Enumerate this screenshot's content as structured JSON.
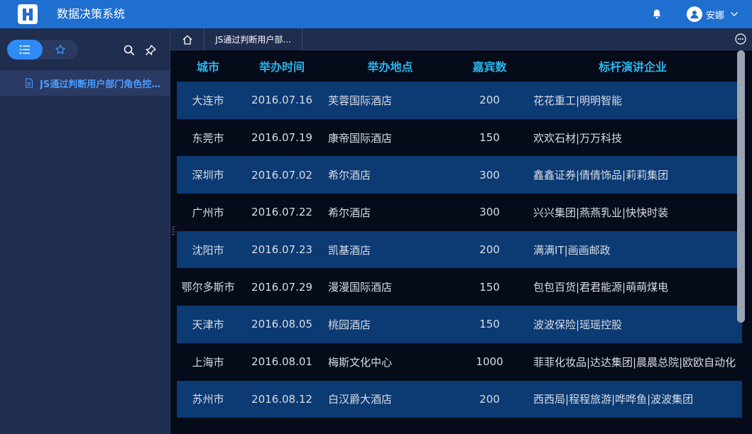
{
  "header": {
    "app_title": "数据决策系统",
    "username": "安娜",
    "logo_icon": "fr-logo-icon",
    "bell_icon": "bell-icon",
    "avatar_icon": "user-avatar-icon"
  },
  "sidebar": {
    "segments": [
      {
        "name": "list",
        "icon": "list-icon",
        "active": true
      },
      {
        "name": "favorites",
        "icon": "star-icon",
        "active": false
      }
    ],
    "items": [
      {
        "label": "JS通过判断用户部门角色控制数据显示",
        "icon": "document-icon",
        "selected": true
      }
    ]
  },
  "tabs": {
    "home_icon": "home-icon",
    "open_tab_label": "JS通过判断用户部...",
    "more_icon": "more-icon"
  },
  "table": {
    "headers": [
      "城市",
      "举办时间",
      "举办地点",
      "嘉宾数",
      "标杆演讲企业"
    ],
    "rows": [
      [
        "大连市",
        "2016.07.16",
        "芙蓉国际酒店",
        "200",
        "花花重工|明明智能"
      ],
      [
        "东莞市",
        "2016.07.19",
        "康帝国际酒店",
        "150",
        "欢欢石材|万万科技"
      ],
      [
        "深圳市",
        "2016.07.02",
        "希尔酒店",
        "300",
        "鑫鑫证券|倩倩饰品|莉莉集团"
      ],
      [
        "广州市",
        "2016.07.22",
        "希尔酒店",
        "300",
        "兴兴集团|燕燕乳业|快快时装"
      ],
      [
        "沈阳市",
        "2016.07.23",
        "凯基酒店",
        "200",
        "满满IT|画画邮政"
      ],
      [
        "鄂尔多斯市",
        "2016.07.29",
        "漫漫国际酒店",
        "150",
        "包包百货|君君能源|萌萌煤电"
      ],
      [
        "天津市",
        "2016.08.05",
        "桃园酒店",
        "150",
        "波波保险|瑶瑶控股"
      ],
      [
        "上海市",
        "2016.08.01",
        "梅斯文化中心",
        "1000",
        "菲菲化妆品|达达集团|晨晨总院|欧欧自动化"
      ],
      [
        "苏州市",
        "2016.08.12",
        "白汉爵大酒店",
        "200",
        "西西局|程程旅游|哗哗鱼|波波集团"
      ]
    ]
  },
  "colors": {
    "topbar": "#1e6fd0",
    "sidebar": "#1f2d4e",
    "header_text": "#2cb5ea",
    "row_alt": "#0c3a73",
    "accent": "#2f8af4"
  }
}
